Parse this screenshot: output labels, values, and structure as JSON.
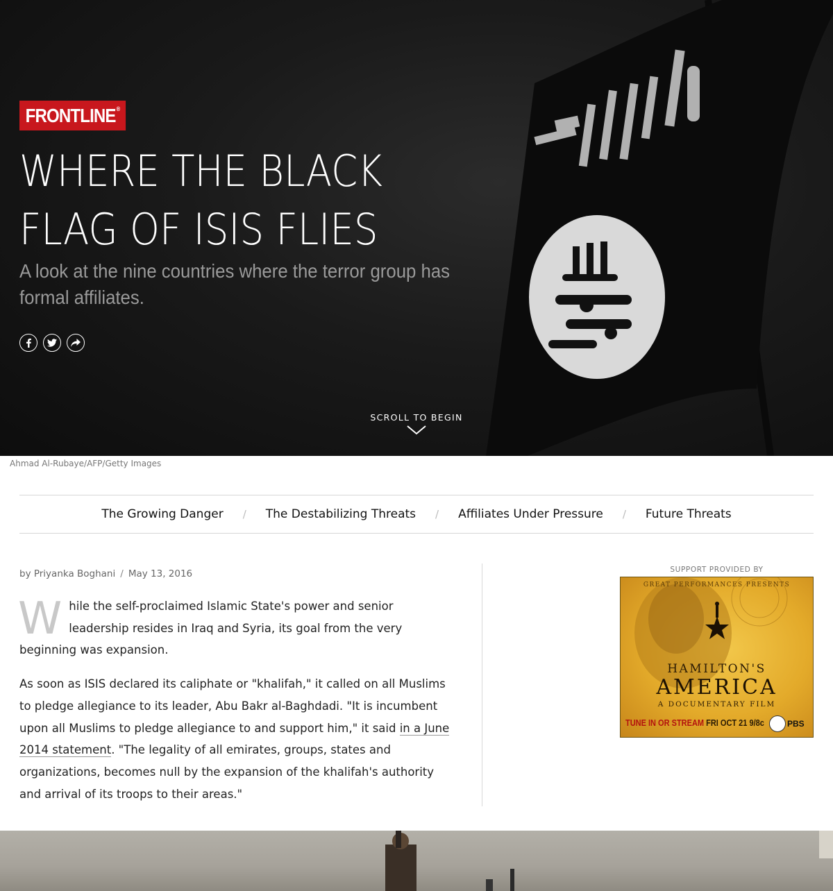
{
  "hero": {
    "logo": "FRONTLINE",
    "logo_mark": "®",
    "title": "WHERE THE BLACK FLAG OF ISIS FLIES",
    "subtitle": "A look at the nine countries where the terror group has formal affiliates.",
    "share": [
      {
        "icon": "facebook-icon"
      },
      {
        "icon": "twitter-icon"
      },
      {
        "icon": "share-icon"
      }
    ],
    "scroll_label": "SCROLL TO BEGIN",
    "photo_credit": "Ahmad Al-Rubaye/AFP/Getty Images"
  },
  "nav": {
    "items": [
      "The Growing Danger",
      "The Destabilizing Threats",
      "Affiliates Under Pressure",
      "Future Threats"
    ],
    "separator": "/"
  },
  "article": {
    "author": "by Priyanka Boghani",
    "separator": "/",
    "date": "May 13, 2016",
    "dropcap": "W",
    "p1": "hile the self-proclaimed Islamic State's power and senior leadership resides in Iraq and Syria, its goal from the very beginning was expansion.",
    "p2_a": "As soon as ISIS declared its caliphate or \"khalifah,\" it called on all Muslims to pledge allegiance to its leader, Abu Bakr al-Baghdadi. \"It is incumbent upon all Muslims to pledge allegiance to and support him,\" it said ",
    "p2_link": "in a June 2014 statement",
    "p2_b": ". \"The legality of all emirates, groups, states and organizations, becomes null by the expansion of the khalifah's authority and arrival of its troops to their areas.\""
  },
  "sponsor": {
    "label": "SUPPORT PROVIDED BY",
    "ad_top": "GREAT PERFORMANCES PRESENTS",
    "ad_hamilton": "HAMILTON'S",
    "ad_america": "AMERICA",
    "ad_doc": "A DOCUMENTARY FILM",
    "ad_tune": "TUNE IN OR STREAM",
    "ad_when": " FRI OCT 21 9/8c",
    "ad_pbs": "PBS"
  },
  "colors": {
    "brand_red": "#c8171d",
    "hero_bg": "#151515",
    "ad_gold": "#e3aa2a"
  }
}
